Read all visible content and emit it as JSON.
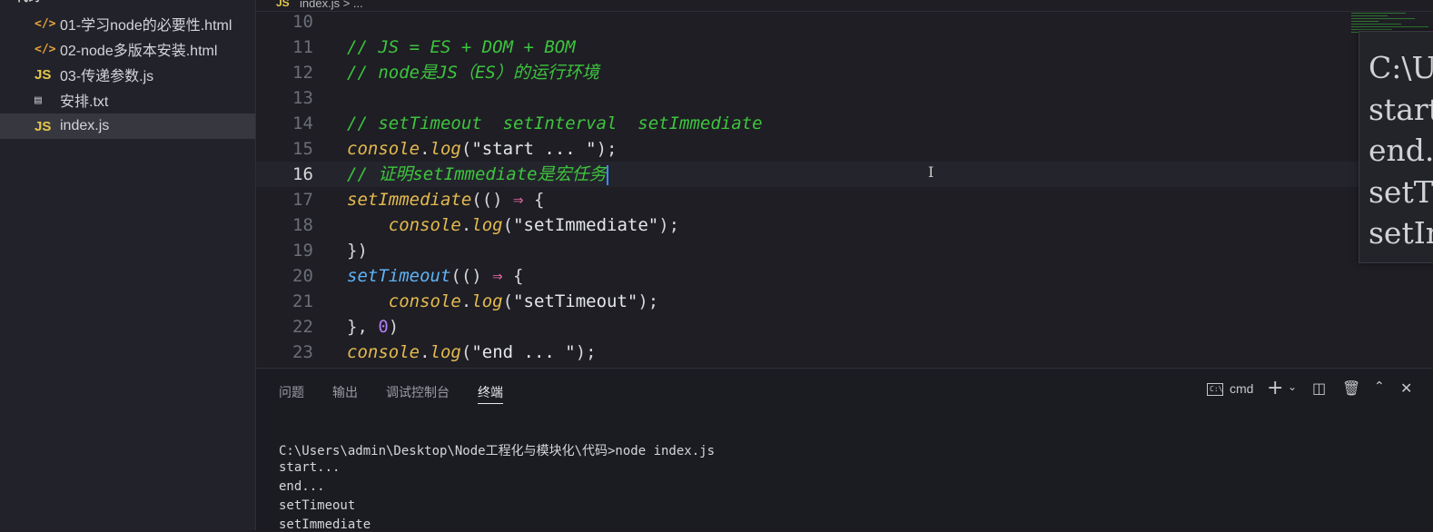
{
  "sidebar": {
    "header": "代码",
    "files": [
      {
        "icon": "html",
        "name": "01-学习node的必要性.html"
      },
      {
        "icon": "html",
        "name": "02-node多版本安装.html"
      },
      {
        "icon": "js",
        "name": "03-传递参数.js"
      },
      {
        "icon": "txt",
        "name": "安排.txt"
      },
      {
        "icon": "js",
        "name": "index.js",
        "selected": true
      }
    ]
  },
  "editor": {
    "tab_label": "index.js > ...",
    "lines": [
      {
        "n": "10"
      },
      {
        "n": "11",
        "comment": "// JS = ES + DOM + BOM"
      },
      {
        "n": "12",
        "comment": "// node是JS（ES）的运行环境"
      },
      {
        "n": "13"
      },
      {
        "n": "14",
        "comment": "// setTimeout  setInterval  setImmediate"
      },
      {
        "n": "15",
        "obj": "console",
        "dot": ".",
        "fn": "log",
        "open": "(",
        "str": "\"start ... \"",
        "close": ");"
      },
      {
        "n": "16",
        "comment": "// 证明setImmediate是宏任务",
        "current": true
      },
      {
        "n": "17",
        "fn": "setImmediate",
        "open": "(() ",
        "arrow": "⇒",
        "close": " {"
      },
      {
        "n": "18",
        "indent": "    ",
        "obj": "console",
        "dot": ".",
        "fn": "log",
        "open": "(",
        "str": "\"setImmediate\"",
        "close": ");"
      },
      {
        "n": "19",
        "close": "})"
      },
      {
        "n": "20",
        "fn": "setTimeout",
        "open": "(() ",
        "arrow": "⇒",
        "close": " {"
      },
      {
        "n": "21",
        "indent": "    ",
        "obj": "console",
        "dot": ".",
        "fn": "log",
        "open": "(",
        "str": "\"setTimeout\"",
        "close": ");"
      },
      {
        "n": "22",
        "close": "}, ",
        "num": "0",
        "close2": ")"
      },
      {
        "n": "23",
        "obj": "console",
        "dot": ".",
        "fn": "log",
        "open": "(",
        "str": "\"end ... \"",
        "close": ");"
      }
    ]
  },
  "zoom_overlay": {
    "lines": [
      "C:\\Users\\admin\\Desk",
      "start...",
      "end...",
      "setTimeout",
      "setImmediate"
    ]
  },
  "panel": {
    "tabs": [
      "问题",
      "输出",
      "调试控制台",
      "终端"
    ],
    "active_tab": "终端",
    "shell_label": "cmd",
    "terminal_lines": [
      "C:\\Users\\admin\\Desktop\\Node工程化与模块化\\代码>node index.js",
      "start...",
      "end...",
      "setTimeout",
      "setImmediate"
    ]
  },
  "colors": {
    "comment": "#3ec43e",
    "function": "#e4b94f",
    "arrow": "#ef6aa6",
    "number": "#b07cf5",
    "caret": "#3d8cff"
  }
}
